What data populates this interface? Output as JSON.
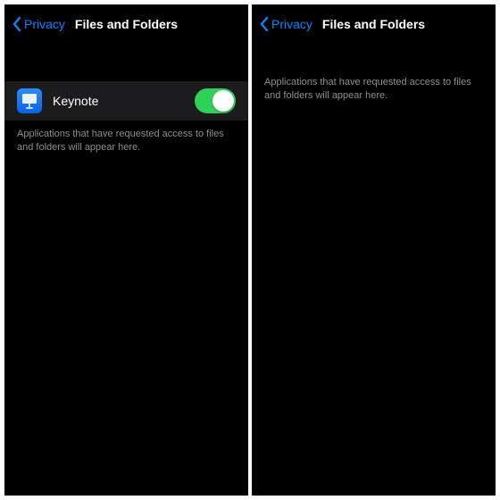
{
  "colors": {
    "accent_blue": "#0a84ff",
    "toggle_green": "#30d158",
    "row_bg": "#1c1c1e",
    "bg": "#000000",
    "secondary_text": "#8e8e93"
  },
  "left_panel": {
    "back_label": "Privacy",
    "title": "Files and Folders",
    "app_row": {
      "icon_name": "keynote-app-icon",
      "label": "Keynote",
      "toggle_on": true
    },
    "footer": "Applications that have requested access to files and folders will appear here."
  },
  "right_panel": {
    "back_label": "Privacy",
    "title": "Files and Folders",
    "footer": "Applications that have requested access to files and folders will appear here."
  }
}
